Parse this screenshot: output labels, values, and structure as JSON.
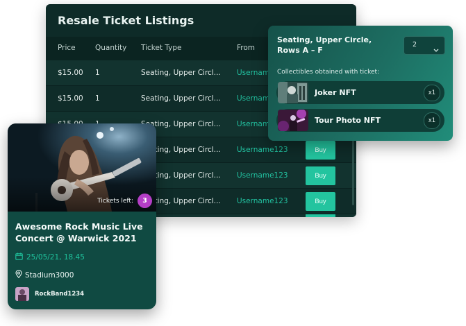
{
  "listings": {
    "title": "Resale Ticket Listings",
    "columns": [
      "Price",
      "Quantity",
      "Ticket Type",
      "From"
    ],
    "rows": [
      {
        "price": "$15.00",
        "quantity": "1",
        "type": "Seating, Upper Circl...",
        "from": "Username123"
      },
      {
        "price": "$15.00",
        "quantity": "1",
        "type": "Seating, Upper Circl...",
        "from": "Username123"
      },
      {
        "price": "$15.00",
        "quantity": "1",
        "type": "Seating, Upper Circl...",
        "from": "Username123"
      },
      {
        "price": "",
        "quantity": "",
        "type": "Seating, Upper Circl...",
        "from": "Username123",
        "buy": "Buy"
      },
      {
        "price": "",
        "quantity": "",
        "type": "Seating, Upper Circl...",
        "from": "Username123",
        "buy": "Buy"
      },
      {
        "price": "",
        "quantity": "",
        "type": "Seating, Upper Circl...",
        "from": "Username123",
        "buy": "Buy"
      }
    ]
  },
  "popup": {
    "title_line1": "Seating, Upper Circle,",
    "title_line2": "Rows A – F",
    "quantity_value": "2",
    "collectibles_label": "Collectibles obtained with ticket:",
    "collectibles": [
      {
        "name": "Joker NFT",
        "count": "x1"
      },
      {
        "name": "Tour Photo NFT",
        "count": "x1"
      }
    ]
  },
  "event": {
    "tickets_left_label": "Tickets left:",
    "tickets_left": "3",
    "title": "Awesome Rock Music Live Concert @ Warwick 2021",
    "date": "25/05/21, 18.45",
    "venue": "Stadium3000",
    "organizer": "RockBand1234"
  },
  "colors": {
    "accent": "#23c49f",
    "badge": "#b43ec6",
    "panel_bg": "#0e2b28"
  }
}
